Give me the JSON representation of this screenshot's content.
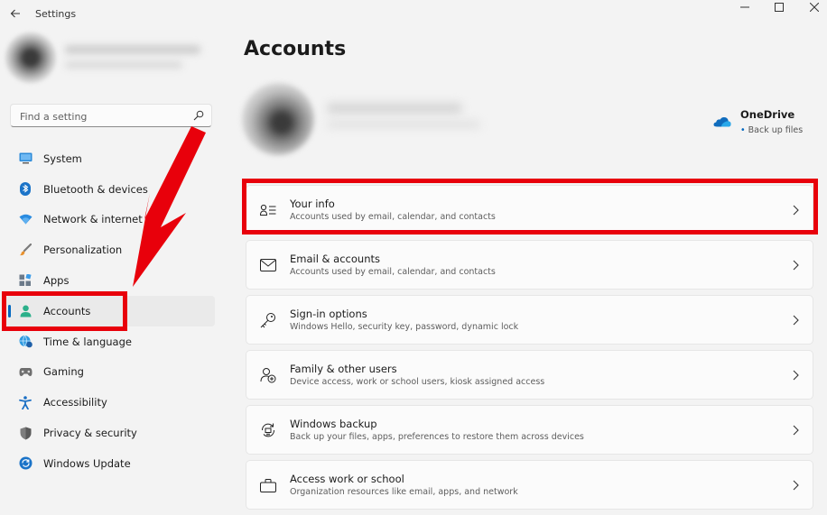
{
  "window": {
    "title": "Settings"
  },
  "search": {
    "placeholder": "Find a setting"
  },
  "sidebar": {
    "items": [
      {
        "label": "System",
        "icon": "monitor-icon"
      },
      {
        "label": "Bluetooth & devices",
        "icon": "bluetooth-icon"
      },
      {
        "label": "Network & internet",
        "icon": "wifi-icon"
      },
      {
        "label": "Personalization",
        "icon": "brush-icon"
      },
      {
        "label": "Apps",
        "icon": "apps-icon"
      },
      {
        "label": "Accounts",
        "icon": "person-icon",
        "active": true
      },
      {
        "label": "Time & language",
        "icon": "globe-clock-icon"
      },
      {
        "label": "Gaming",
        "icon": "gamepad-icon"
      },
      {
        "label": "Accessibility",
        "icon": "accessibility-icon"
      },
      {
        "label": "Privacy & security",
        "icon": "shield-icon"
      },
      {
        "label": "Windows Update",
        "icon": "update-icon"
      }
    ]
  },
  "main": {
    "title": "Accounts",
    "onedrive": {
      "title": "OneDrive",
      "subtitle": "Back up files"
    },
    "cards": [
      {
        "title": "Your info",
        "subtitle": "Accounts used by email, calendar, and contacts",
        "icon": "person-list-icon"
      },
      {
        "title": "Email & accounts",
        "subtitle": "Accounts used by email, calendar, and contacts",
        "icon": "mail-icon"
      },
      {
        "title": "Sign-in options",
        "subtitle": "Windows Hello, security key, password, dynamic lock",
        "icon": "key-icon"
      },
      {
        "title": "Family & other users",
        "subtitle": "Device access, work or school users, kiosk assigned access",
        "icon": "person-add-icon"
      },
      {
        "title": "Windows backup",
        "subtitle": "Back up your files, apps, preferences to restore them across devices",
        "icon": "backup-icon"
      },
      {
        "title": "Access work or school",
        "subtitle": "Organization resources like email, apps, and network",
        "icon": "briefcase-icon"
      }
    ]
  },
  "colors": {
    "accent": "#0067c0",
    "annotation": "#e8000b",
    "background": "#f3f3f3",
    "card": "#fbfbfb"
  }
}
